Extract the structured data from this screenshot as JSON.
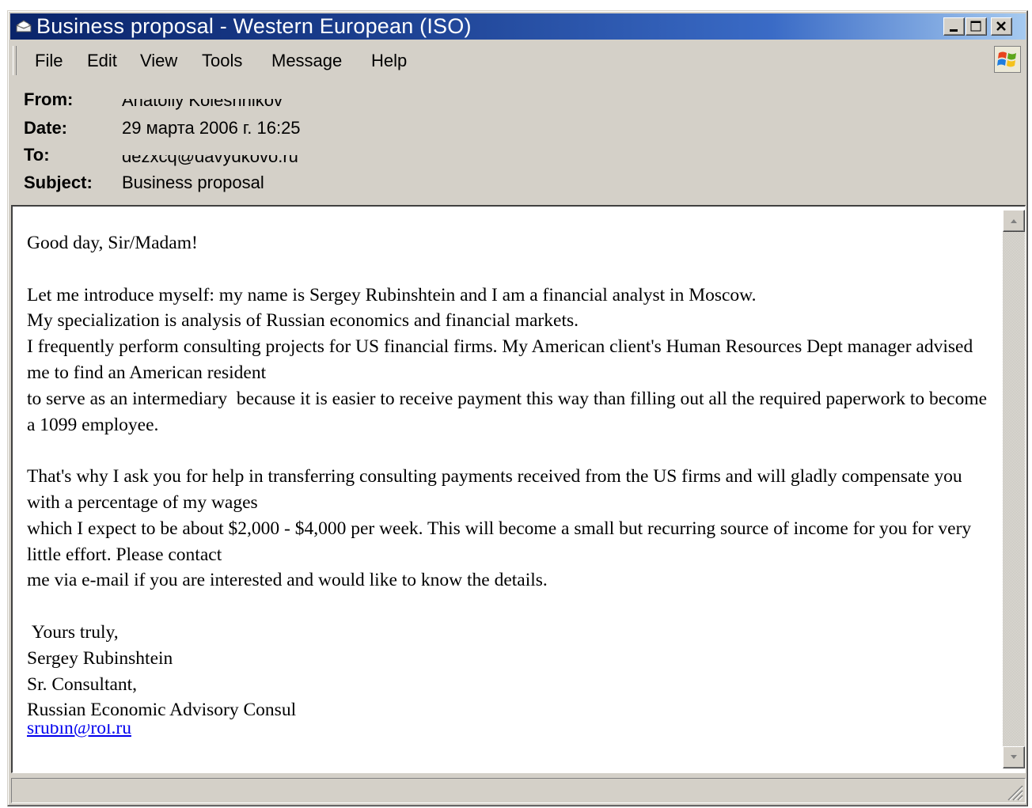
{
  "window": {
    "title": "Business proposal - Western European (ISO)",
    "title_icon": "outlook-express-envelope-icon"
  },
  "title_buttons": {
    "minimize": "minimize-icon",
    "maximize": "maximize-icon",
    "close": "close-icon"
  },
  "menu": {
    "items": [
      "File",
      "Edit",
      "View",
      "Tools",
      "Message",
      "Help"
    ],
    "logo_icon": "windows-logo-icon"
  },
  "headers": {
    "from_label": "From:",
    "from_value": "Anatoliy Koleshnikov",
    "date_label": "Date:",
    "date_value": "29 марта 2006 г. 16:25",
    "to_label": "To:",
    "to_value": "dezxcq@davydkovo.ru",
    "subject_label": "Subject:",
    "subject_value": "Business proposal"
  },
  "message": {
    "body": "Good day, Sir/Madam!\n\nLet me introduce myself: my name is Sergey Rubinshtein and I am a financial analyst in Moscow.\nMy specialization is analysis of Russian economics and financial markets.\nI frequently perform consulting projects for US financial firms. My American client's Human Resources Dept manager advised me to find an American resident\nto serve as an intermediary  because it is easier to receive payment this way than filling out all the required paperwork to become a 1099 employee.\n\nThat's why I ask you for help in transferring consulting payments received from the US firms and will gladly compensate you with a percentage of my wages\nwhich I expect to be about $2,000 - $4,000 per week. This will become a small but recurring source of income for you for very little effort. Please contact\nme via e-mail if you are interested and would like to know the details.\n\n Yours truly,\nSergey Rubinshtein\nSr. Consultant,\nRussian Economic Advisory Consul",
    "link": "srubin@rol.ru"
  },
  "colors": {
    "title_gradient_start": "#0a246a",
    "title_gradient_end": "#a6caf0",
    "face": "#d4d0c8",
    "link": "#0000ee"
  }
}
